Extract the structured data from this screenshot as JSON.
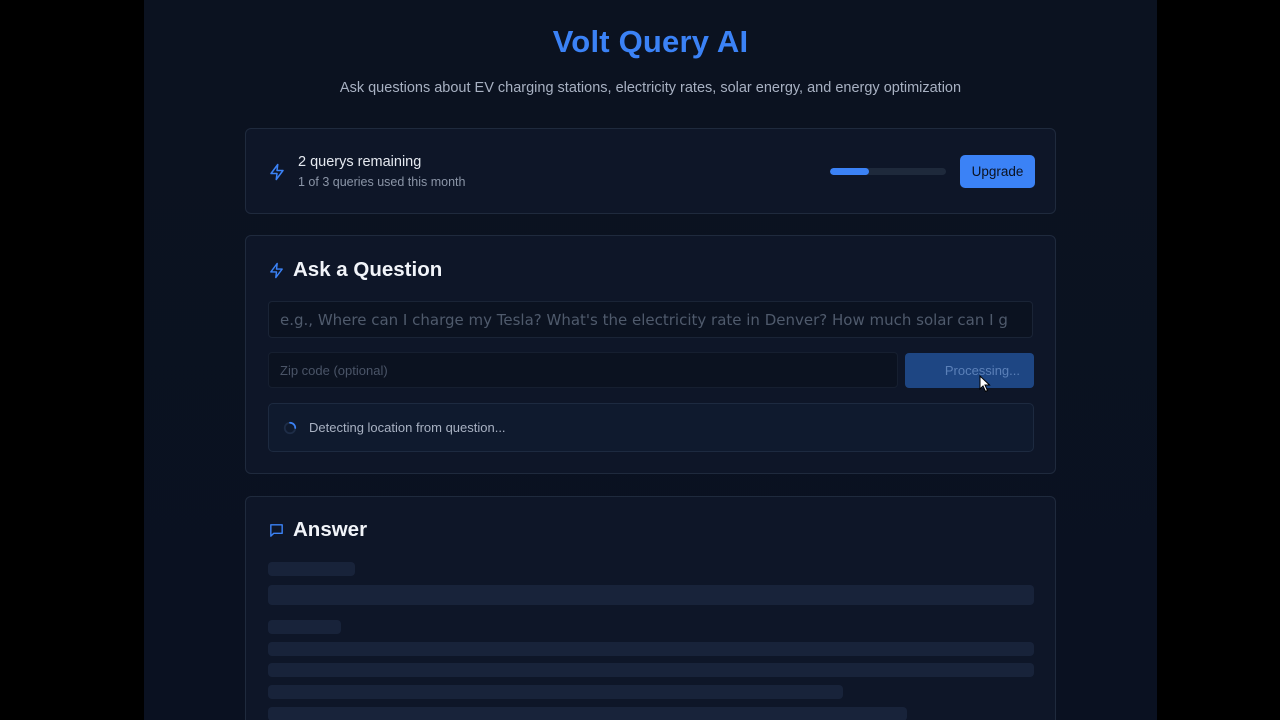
{
  "header": {
    "title": "Volt Query AI",
    "subtitle": "Ask questions about EV charging stations, electricity rates, solar energy, and energy optimization"
  },
  "usage": {
    "icon": "lightning-icon",
    "remaining_label": "2 querys remaining",
    "used_label": "1 of 3 queries used this month",
    "used_fraction": 0.333,
    "upgrade_label": "Upgrade"
  },
  "ask": {
    "icon": "lightning-icon",
    "title": "Ask a Question",
    "question_placeholder": "e.g., Where can I charge my Tesla? What's the electricity rate in Denver? How much solar can I g",
    "zip_placeholder": "Zip code (optional)",
    "submit_label": "Processing...",
    "status_icon": "spinner-icon",
    "status_text": "Detecting location from question..."
  },
  "answer": {
    "icon": "chat-bubble-icon",
    "title": "Answer"
  },
  "colors": {
    "accent": "#3b82f6",
    "background": "#0b1220",
    "card": "#0e1628",
    "button_disabled": "#1e4683",
    "skeleton": "#18233a"
  }
}
